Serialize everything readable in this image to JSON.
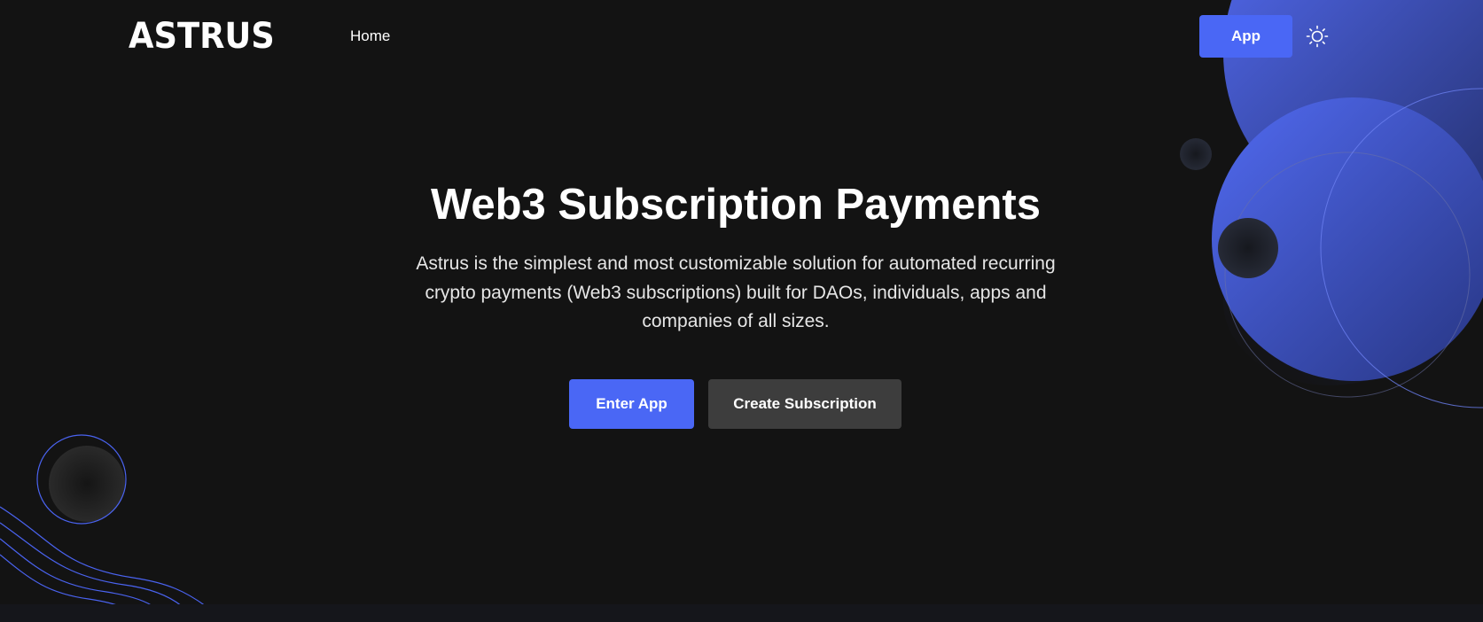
{
  "header": {
    "logo_text": "ASTRUS",
    "nav": [
      {
        "label": "Home"
      }
    ],
    "app_button_label": "App",
    "theme_toggle_icon": "sun-icon"
  },
  "hero": {
    "title": "Web3 Subscription Payments",
    "subtitle": "Astrus is the simplest and most customizable solution for automated recurring crypto payments (Web3 subscriptions) built for DAOs, individuals, apps and companies of all sizes.",
    "primary_button_label": "Enter App",
    "secondary_button_label": "Create Subscription"
  },
  "colors": {
    "background": "#131313",
    "accent": "#4a67f5",
    "secondary_button": "#3d3d3d",
    "text": "#ffffff"
  }
}
